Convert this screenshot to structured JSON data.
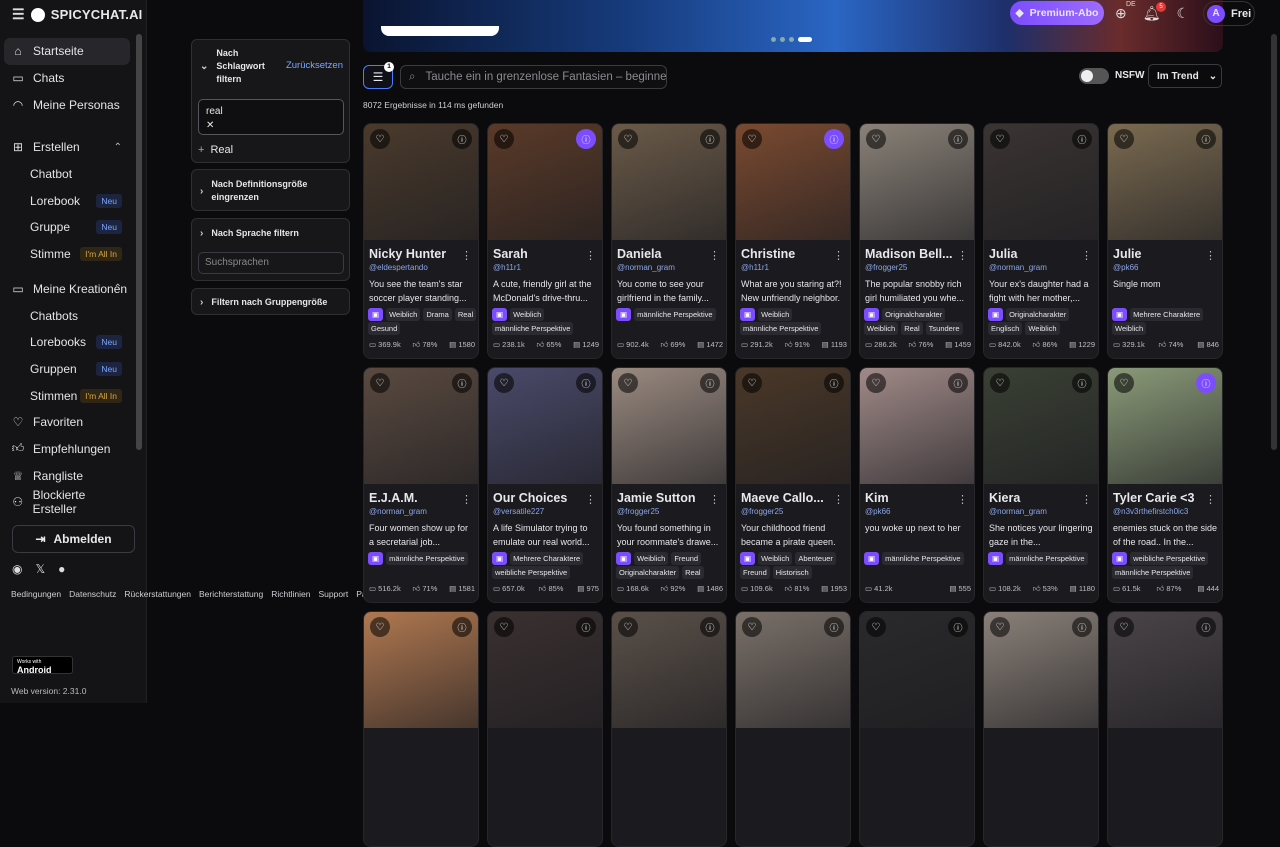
{
  "header": {
    "brand": "SPICYCHAT.AI",
    "premium_label": "Premium-Abo",
    "lang": "DE",
    "notif_count": "5",
    "user_initial": "A",
    "user_plan": "Frei"
  },
  "sidebar": {
    "items": [
      {
        "label": "Startseite",
        "icon": "home-icon",
        "type": "main",
        "active": true
      },
      {
        "label": "Chats",
        "icon": "chat-icon",
        "type": "main"
      },
      {
        "label": "Meine Personas",
        "icon": "mask-icon",
        "type": "main"
      },
      {
        "label": "Erstellen",
        "icon": "plus-square-icon",
        "type": "section"
      },
      {
        "label": "Chatbot",
        "type": "sub"
      },
      {
        "label": "Lorebook",
        "type": "sub",
        "badge": "Neu"
      },
      {
        "label": "Gruppe",
        "type": "sub",
        "badge": "Neu"
      },
      {
        "label": "Stimme",
        "type": "sub",
        "badge": "I'm All In",
        "gold": true
      },
      {
        "label": "Meine Kreationen",
        "icon": "folder-icon",
        "type": "section"
      },
      {
        "label": "Chatbots",
        "type": "sub"
      },
      {
        "label": "Lorebooks",
        "type": "sub",
        "badge": "Neu"
      },
      {
        "label": "Gruppen",
        "type": "sub",
        "badge": "Neu"
      },
      {
        "label": "Stimmen",
        "type": "sub",
        "badge": "I'm All In",
        "gold": true
      },
      {
        "label": "Favoriten",
        "icon": "heart-icon",
        "type": "main"
      },
      {
        "label": "Empfehlungen",
        "icon": "thumbs-up-icon",
        "type": "main"
      },
      {
        "label": "Rangliste",
        "icon": "trophy-icon",
        "type": "main"
      },
      {
        "label": "Blockierte Ersteller",
        "icon": "user-block-icon",
        "type": "main"
      }
    ],
    "logout": "Abmelden",
    "links": [
      "Bedingungen",
      "Datenschutz",
      "Rückerstattungen",
      "Berichterstattung",
      "Richtlinien",
      "Support",
      "Partner"
    ],
    "android_small": "Works with",
    "android": "Android",
    "version": "Web version: 2.31.0"
  },
  "filters": {
    "keyword_title": "Nach Schlagwort filtern",
    "reset": "Zurücksetzen",
    "keyword_value": "real",
    "keyword_option": "Real",
    "definition_title": "Nach Definitionsgröße eingrenzen",
    "language_title": "Nach Sprache filtern",
    "language_placeholder": "Suchsprachen",
    "group_title": "Filtern nach Gruppengröße"
  },
  "toolbar": {
    "filter_count": "1",
    "search_placeholder": "Tauche ein in grenzenlose Fantasien – beginne",
    "nsfw": "NSFW",
    "sort": "Im Trend",
    "results": "8072 Ergebnisse in 114 ms gefunden"
  },
  "cards": [
    {
      "name": "Nicky Hunter",
      "handle": "@eldespertando",
      "desc": "You see the team's star soccer player standing...",
      "tags": [
        "Weiblich",
        "Drama",
        "Real",
        "Gesund"
      ],
      "chats": "369.9k",
      "likes": "78%",
      "tokens": "1580",
      "bg": "#4a3a2c",
      "purple": false
    },
    {
      "name": "Sarah",
      "handle": "@h11r1",
      "desc": "A cute, friendly girl at the McDonald's drive-thru...",
      "tags": [
        "Weiblich",
        "männliche Perspektive"
      ],
      "chats": "238.1k",
      "likes": "65%",
      "tokens": "1249",
      "bg": "#5a3a28",
      "purple": true
    },
    {
      "name": "Daniela",
      "handle": "@norman_gram",
      "desc": "You come to see your girlfriend in the family...",
      "tags": [
        "männliche Perspektive"
      ],
      "chats": "902.4k",
      "likes": "69%",
      "tokens": "1472",
      "bg": "#6a5a48",
      "purple": false
    },
    {
      "name": "Christine",
      "handle": "@h11r1",
      "desc": "What are you staring at?! New unfriendly neighbor.",
      "tags": [
        "Weiblich",
        "männliche Perspektive"
      ],
      "chats": "291.2k",
      "likes": "91%",
      "tokens": "1193",
      "bg": "#7a4a30",
      "purple": true
    },
    {
      "name": "Madison Bell...",
      "handle": "@frogger25",
      "desc": "The popular snobby rich girl humiliated you whe...",
      "tags": [
        "Originalcharakter",
        "Weiblich",
        "Real",
        "Tsundere"
      ],
      "chats": "286.2k",
      "likes": "76%",
      "tokens": "1459",
      "bg": "#8a8278",
      "purple": false
    },
    {
      "name": "Julia",
      "handle": "@norman_gram",
      "desc": "Your ex's daughter had a fight with her mother,...",
      "tags": [
        "Originalcharakter",
        "Englisch",
        "Weiblich"
      ],
      "chats": "842.0k",
      "likes": "86%",
      "tokens": "1229",
      "bg": "#3a3432",
      "purple": false
    },
    {
      "name": "Julie",
      "handle": "@pk66",
      "desc": "Single mom",
      "tags": [
        "Mehrere Charaktere",
        "Weiblich"
      ],
      "chats": "329.1k",
      "likes": "74%",
      "tokens": "846",
      "bg": "#7a6a50",
      "purple": false
    },
    {
      "name": "E.J.A.M.",
      "handle": "@norman_gram",
      "desc": "Four women show up for a secretarial job...",
      "tags": [
        "männliche Perspektive"
      ],
      "chats": "516.2k",
      "likes": "71%",
      "tokens": "1581",
      "bg": "#5a4a40",
      "purple": false
    },
    {
      "name": "Our Choices",
      "handle": "@versatile227",
      "desc": "A life Simulator trying to emulate our real world...",
      "tags": [
        "Mehrere Charaktere",
        "weibliche Perspektive"
      ],
      "chats": "657.0k",
      "likes": "85%",
      "tokens": "975",
      "bg": "#4a4a6a",
      "purple": false
    },
    {
      "name": "Jamie Sutton",
      "handle": "@frogger25",
      "desc": "You found something in your roommate's drawe...",
      "tags": [
        "Weiblich",
        "Freund",
        "Originalcharakter",
        "Real"
      ],
      "chats": "168.6k",
      "likes": "92%",
      "tokens": "1486",
      "bg": "#9a8a80",
      "purple": false
    },
    {
      "name": "Maeve Callo...",
      "handle": "@frogger25",
      "desc": "Your childhood friend became a pirate queen.",
      "tags": [
        "Weiblich",
        "Abenteuer",
        "Freund",
        "Historisch"
      ],
      "chats": "109.6k",
      "likes": "81%",
      "tokens": "1953",
      "bg": "#4a3828",
      "purple": false
    },
    {
      "name": "Kim",
      "handle": "@pk66",
      "desc": "you woke up next to her",
      "tags": [
        "männliche Perspektive"
      ],
      "chats": "41.2k",
      "likes": "",
      "tokens": "555",
      "bg": "#a08a88",
      "purple": false
    },
    {
      "name": "Kiera",
      "handle": "@norman_gram",
      "desc": "She notices your lingering gaze in the...",
      "tags": [
        "männliche Perspektive"
      ],
      "chats": "108.2k",
      "likes": "53%",
      "tokens": "1180",
      "bg": "#3a4034",
      "purple": false
    },
    {
      "name": "Tyler Carie <3",
      "handle": "@n3v3rthefirstch0ic3",
      "desc": "enemies stuck on the side of the road.. In the...",
      "tags": [
        "weibliche Perspektive",
        "männliche Perspektive"
      ],
      "chats": "61.5k",
      "likes": "87%",
      "tokens": "444",
      "bg": "#8a9a78",
      "purple": true
    },
    {
      "bg": "#b07850",
      "purple": false
    },
    {
      "bg": "#3a3030",
      "purple": false
    },
    {
      "bg": "#5a5048",
      "purple": false
    },
    {
      "bg": "#7a7068",
      "purple": false
    },
    {
      "bg": "#2a2a2c",
      "purple": false
    },
    {
      "bg": "#8a8078",
      "purple": false
    },
    {
      "bg": "#4a4448",
      "purple": false
    }
  ]
}
